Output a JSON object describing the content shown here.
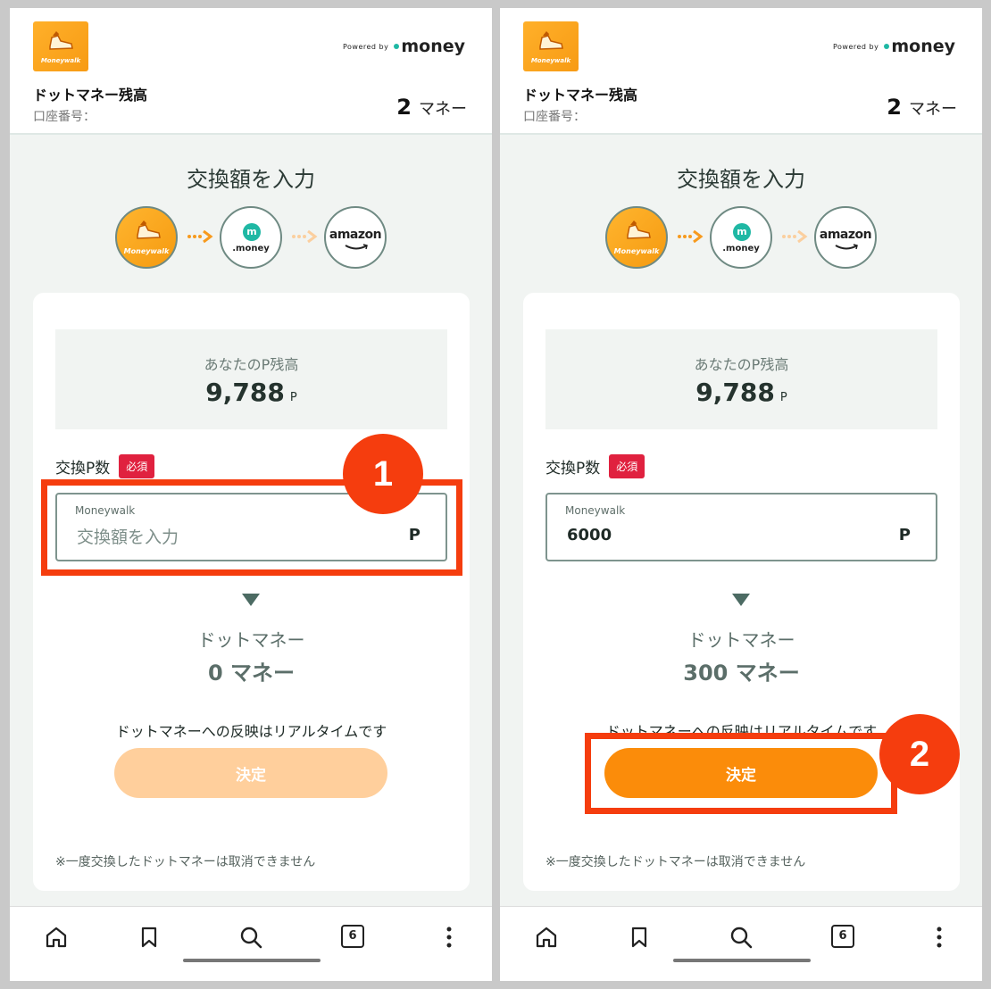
{
  "header": {
    "powered_by": "Powered by",
    "money_brand": "money",
    "logo_text": "Moneywalk",
    "balance_title": "ドットマネー残高",
    "account_label": "口座番号：",
    "balance_value": "2",
    "balance_unit": "マネー"
  },
  "page": {
    "title": "交換額を入力",
    "flow": {
      "moneywalk_label": "Moneywalk",
      "dotmoney_label": ".money",
      "dotmoney_badge": "m",
      "amazon_label": "amazon"
    }
  },
  "card": {
    "balance_label": "あなたのP残高",
    "balance_value": "9,788",
    "balance_unit": "P",
    "field_label": "交換P数",
    "required_badge": "必須",
    "input_label": "Moneywalk",
    "input_placeholder": "交換額を入力",
    "input_unit": "P",
    "dotmoney_label": "ドットマネー",
    "realtime_note": "ドットマネーへの反映はリアルタイムです",
    "submit_label": "決定",
    "cancel_note": "※一度交換したドットマネーは取消できません"
  },
  "left": {
    "input_value": "",
    "dotmoney_value": "0 マネー",
    "button_enabled": false
  },
  "right": {
    "input_value": "6000",
    "dotmoney_value": "300 マネー",
    "button_enabled": true
  },
  "nav": {
    "tabs_count": "6"
  },
  "callouts": {
    "step1": "1",
    "step2": "2"
  },
  "colors": {
    "accent_orange": "#fb8c0a",
    "disabled_orange": "#ffcf9c",
    "required_red": "#e0213f",
    "callout_red": "#f53d0e",
    "dotmoney_teal": "#1fb8a4"
  }
}
